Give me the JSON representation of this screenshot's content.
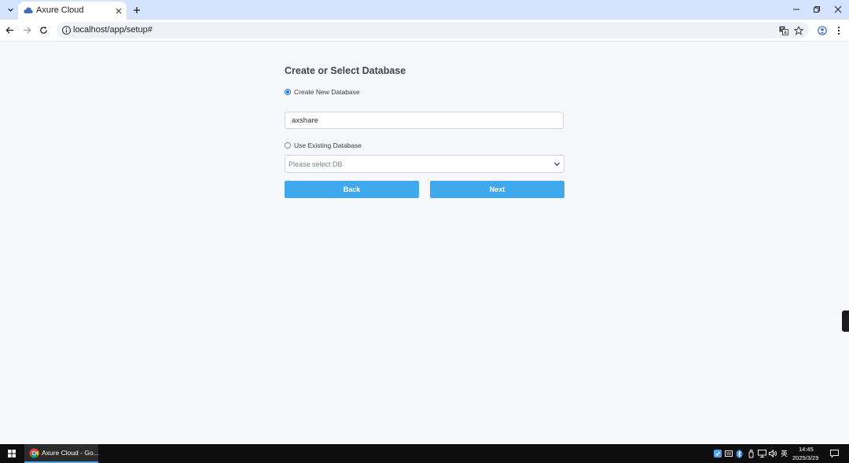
{
  "browser": {
    "tab_title": "Axure Cloud",
    "url": "localhost/app/setup#"
  },
  "setup": {
    "title": "Create or Select Database",
    "create_new_label": "Create New Database",
    "create_new_checked": true,
    "database_name_value": "axshare",
    "use_existing_label": "Use Existing Database",
    "use_existing_checked": false,
    "select_placeholder": "Please select DB",
    "back_label": "Back",
    "next_label": "Next",
    "button_color": "#40a9ed"
  },
  "taskbar": {
    "app_label": "Axure Cloud - Go...",
    "ime_label": "英",
    "time": "14:45",
    "date": "2025/3/29"
  }
}
